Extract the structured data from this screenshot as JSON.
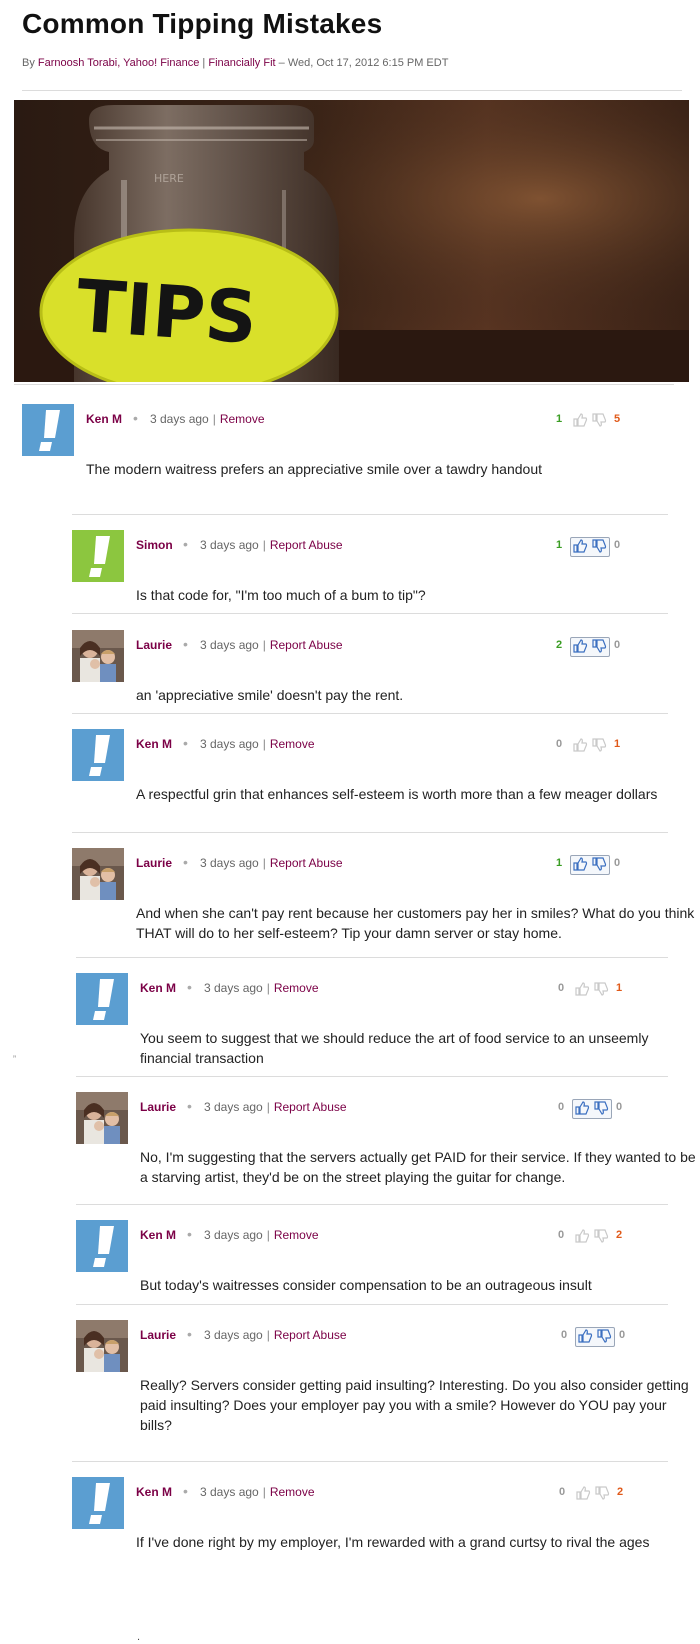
{
  "article": {
    "title": "Common Tipping Mistakes",
    "byline_prefix": "By",
    "byline_author": "Farnoosh Torabi, Yahoo! Finance",
    "byline_sep": "|",
    "byline_column": "Financially Fit",
    "byline_date": "– Wed, Oct 17, 2012 6:15 PM EDT",
    "hero_label": "TIPS",
    "hero_jar_text": "HERE"
  },
  "comments": [
    {
      "author": "Ken M",
      "time": "3 days ago",
      "action": "Remove",
      "text": "The modern waitress prefers an appreciative smile over a tawdry handout",
      "up": "1",
      "down": "5",
      "avatar": "default-blue",
      "thumbs_active": false
    },
    {
      "author": "Simon",
      "time": "3 days ago",
      "action": "Report Abuse",
      "text": "Is that code for, \"I'm too much of a bum to tip\"?",
      "up": "1",
      "down": "0",
      "avatar": "default-green",
      "thumbs_active": true
    },
    {
      "author": "Laurie",
      "time": "3 days ago",
      "action": "Report Abuse",
      "text": "an 'appreciative smile' doesn't pay the rent.",
      "up": "2",
      "down": "0",
      "avatar": "photo",
      "thumbs_active": true
    },
    {
      "author": "Ken M",
      "time": "3 days ago",
      "action": "Remove",
      "text": "A respectful grin that enhances self-esteem is worth more than a few meager dollars",
      "up": "0",
      "down": "1",
      "avatar": "default-blue",
      "thumbs_active": false
    },
    {
      "author": "Laurie",
      "time": "3 days ago",
      "action": "Report Abuse",
      "text": "And when she can't pay rent because her customers pay her in smiles? What do you think THAT will do to her self-esteem? Tip your damn server or stay home.",
      "up": "1",
      "down": "0",
      "avatar": "photo",
      "thumbs_active": true
    },
    {
      "author": "Ken M",
      "time": "3 days ago",
      "action": "Remove",
      "text": "You seem to suggest that we should reduce the art of food service to an unseemly financial transaction",
      "up": "0",
      "down": "1",
      "avatar": "default-blue",
      "thumbs_active": false
    },
    {
      "author": "Laurie",
      "time": "3 days ago",
      "action": "Report Abuse",
      "text": "No, I'm suggesting that the servers actually get PAID for their service. If they wanted to be a starving artist, they'd be on the street playing the guitar for change.",
      "up": "0",
      "down": "0",
      "avatar": "photo",
      "thumbs_active": true
    },
    {
      "author": "Ken M",
      "time": "3 days ago",
      "action": "Remove",
      "text": "But today's waitresses consider compensation to be an outrageous insult",
      "up": "0",
      "down": "2",
      "avatar": "default-blue",
      "thumbs_active": false
    },
    {
      "author": "Laurie",
      "time": "3 days ago",
      "action": "Report Abuse",
      "text": "Really? Servers consider getting paid insulting? Interesting. Do you also consider getting paid insulting? Does your employer pay you with a smile? However do YOU pay your bills?",
      "up": "0",
      "down": "0",
      "avatar": "photo",
      "thumbs_active": true
    },
    {
      "author": "Ken M",
      "time": "3 days ago",
      "action": "Remove",
      "text": "If I've done right by my employer, I'm rewarded with a grand curtsy to rival the ages",
      "up": "0",
      "down": "2",
      "avatar": "default-blue",
      "thumbs_active": false
    }
  ],
  "stray_char": "”",
  "trailing_char": "."
}
